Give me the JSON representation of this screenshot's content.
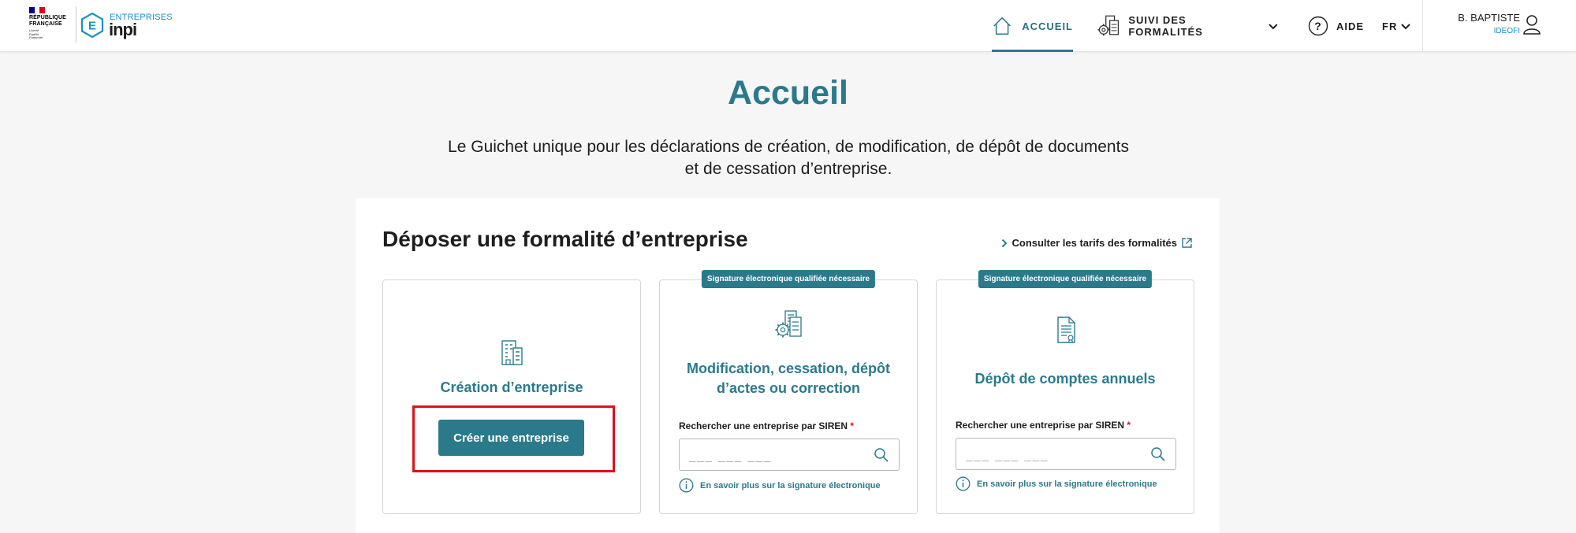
{
  "header": {
    "logo_rf": {
      "line1": "RÉPUBLIQUE",
      "line2": "FRANÇAISE",
      "motto": [
        "Liberté",
        "Égalité",
        "Fraternité"
      ]
    },
    "logo_inpi": {
      "small": "ENTREPRISES",
      "big": "inpi",
      "mark": "E"
    },
    "nav": {
      "accueil": "ACCUEIL",
      "suivi": "SUIVI DES FORMALITÉS",
      "aide": "AIDE",
      "lang": "FR"
    },
    "user": {
      "name": "B. BAPTISTE",
      "org": "IDEOFI"
    }
  },
  "main": {
    "title": "Accueil",
    "subtitle": "Le Guichet unique pour les déclarations de création, de modification, de dépôt de documents et de cessation d’entreprise."
  },
  "panel": {
    "title": "Déposer une formalité d’entreprise",
    "tarifs_link": "Consulter les tarifs des formalités",
    "cards": [
      {
        "title": "Création d’entreprise",
        "button": "Créer une entreprise"
      },
      {
        "badge": "Signature électronique qualifiée nécessaire",
        "title": "Modification, cessation, dépôt d’actes ou correction",
        "field_label": "Rechercher une entreprise par SIREN",
        "required_mark": "*",
        "placeholder": "___ ___ ___",
        "info": "En savoir plus sur la signature électronique"
      },
      {
        "badge": "Signature électronique qualifiée nécessaire",
        "title": "Dépôt de comptes annuels",
        "field_label": "Rechercher une entreprise par SIREN",
        "required_mark": "*",
        "placeholder": "___ ___ ___",
        "info": "En savoir plus sur la signature électronique"
      }
    ]
  },
  "colors": {
    "primary": "#2a7a8c",
    "accent_blue": "#1a8fc9",
    "highlight_red": "#e0101a",
    "background": "#f6f6f6"
  },
  "icons": [
    "home-icon",
    "formalities-gear-icon",
    "help-icon",
    "chevron-down-icon",
    "user-icon",
    "building-icon",
    "gear-document-icon",
    "document-icon",
    "search-icon",
    "info-icon",
    "external-link-icon"
  ]
}
